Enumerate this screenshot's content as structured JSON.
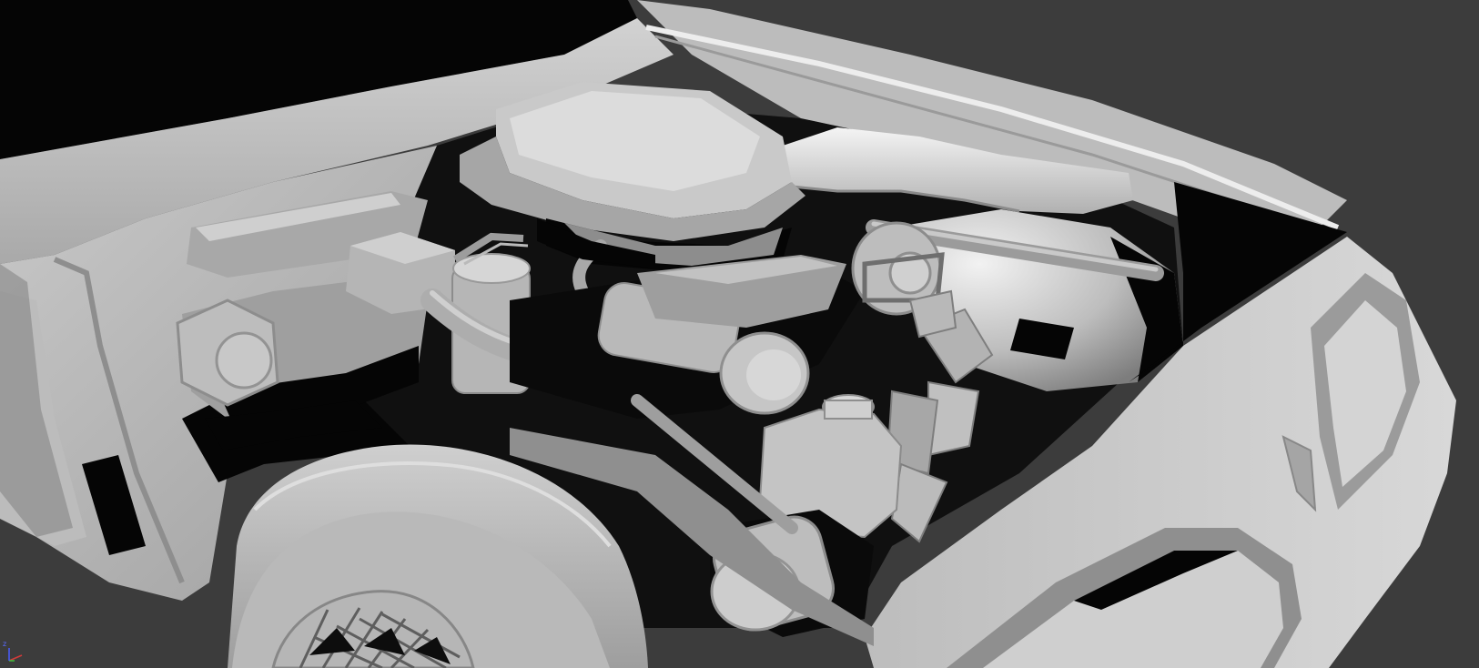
{
  "viewport": {
    "background_color": "#3c3c3c",
    "render_mode": "shaded",
    "subject": "car-engine-bay-model"
  },
  "axis_gizmo": {
    "z_label": "z",
    "colors": {
      "x": "#d23a3a",
      "y": "#3ac23a",
      "z": "#4a5cff"
    }
  },
  "colors": {
    "shadow": "#050505",
    "body_light": "#c8c8c8",
    "body_mid": "#a8a8a8",
    "body_dark": "#8a8a8a",
    "highlight": "#f2f2f2"
  }
}
